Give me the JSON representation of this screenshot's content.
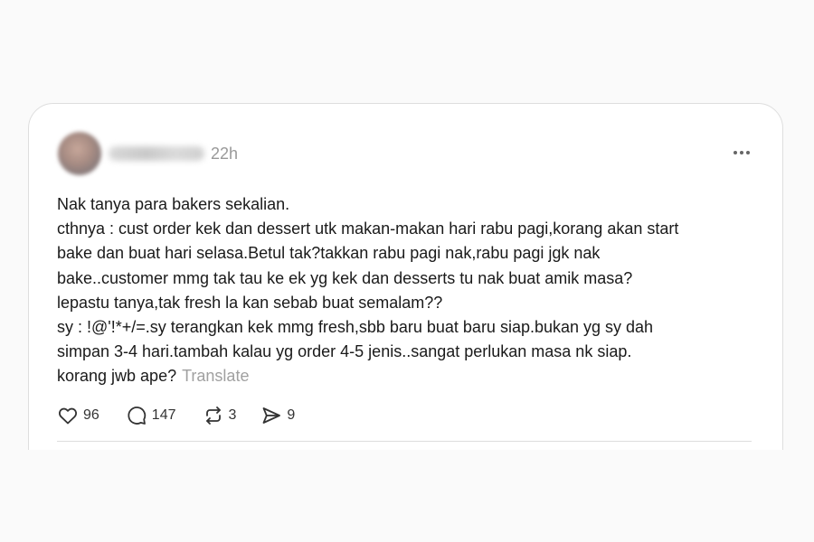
{
  "post": {
    "timestamp": "22h",
    "lines": [
      "Nak tanya para bakers sekalian.",
      "cthnya : cust order kek dan dessert utk makan-makan hari rabu pagi,korang akan start",
      "bake dan buat hari selasa.Betul tak?takkan rabu pagi nak,rabu pagi jgk nak",
      "bake..customer mmg tak tau ke ek yg kek dan desserts tu nak buat amik masa?",
      "lepastu tanya,tak fresh la kan sebab buat semalam??",
      "sy : !@'!*+/=.sy terangkan kek mmg fresh,sbb baru buat baru siap.bukan yg sy dah",
      "simpan 3-4 hari.tambah kalau yg order 4-5 jenis..sangat perlukan masa nk siap.",
      "korang jwb ape?"
    ],
    "translate_label": "Translate"
  },
  "actions": {
    "likes": "96",
    "replies": "147",
    "reposts": "3",
    "shares": "9"
  },
  "icons": {
    "like": "heart-icon",
    "reply": "comment-bubble-icon",
    "repost": "repost-arrows-icon",
    "share": "send-paper-plane-icon",
    "more": "more-horizontal-icon"
  }
}
